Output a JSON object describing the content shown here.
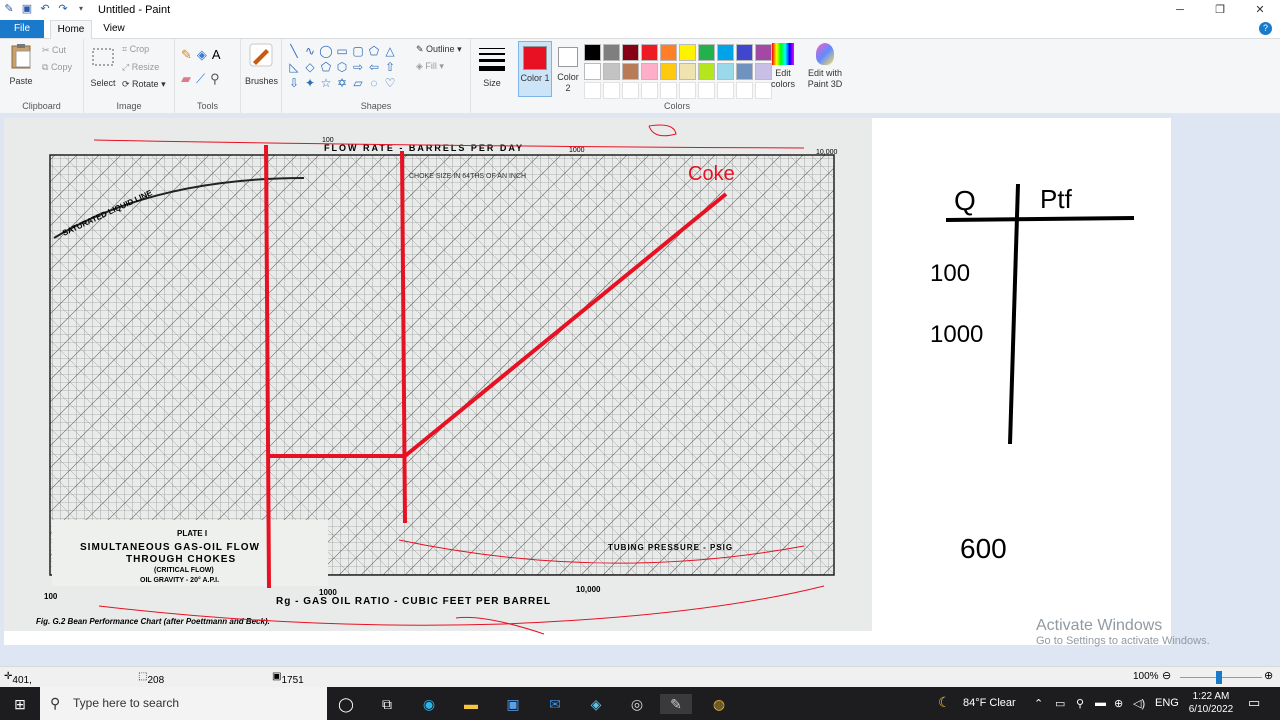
{
  "window": {
    "title": "Untitled - Paint",
    "controls": [
      "minimize-icon",
      "maximize-icon",
      "close-icon"
    ]
  },
  "tabs": {
    "file": "File",
    "home": "Home",
    "view": "View"
  },
  "ribbon": {
    "clipboard": {
      "paste": "Paste",
      "cut": "Cut",
      "copy": "Copy",
      "label": "Clipboard"
    },
    "image": {
      "select": "Select",
      "crop": "Crop",
      "resize": "Resize",
      "rotate": "Rotate",
      "label": "Image"
    },
    "tools": {
      "label": "Tools"
    },
    "brushes": {
      "label": "Brushes"
    },
    "shapes": {
      "outline": "Outline",
      "fill": "Fill",
      "label": "Shapes"
    },
    "size": {
      "label": "Size"
    },
    "colors": {
      "color1": "Color 1",
      "color2": "Color 2",
      "edit_colors": "Edit colors",
      "edit_paint3d": "Edit with Paint 3D",
      "label": "Colors",
      "color1_value": "#e81123",
      "color2_value": "#ffffff",
      "palette": [
        "#000000",
        "#7f7f7f",
        "#880015",
        "#ed1c24",
        "#ff7f27",
        "#fff200",
        "#22b14c",
        "#00a2e8",
        "#3f48cc",
        "#a349a4",
        "#ffffff",
        "#c3c3c3",
        "#b97a57",
        "#ffaec9",
        "#ffc90e",
        "#efe4b0",
        "#b5e61d",
        "#99d9ea",
        "#7092be",
        "#c8bfe7"
      ]
    }
  },
  "chart_image": {
    "top_label": "FLOW RATE - BARRELS PER DAY",
    "top_ticks": [
      "100",
      "1000",
      "10,000"
    ],
    "choke_label": "CHOKE SIZE IN 64THS OF AN INCH",
    "liquid_line": "SATURATED LIQUID LINE",
    "plate_title": "PLATE I",
    "plate_line1": "SIMULTANEOUS GAS-OIL FLOW",
    "plate_line2": "THROUGH CHOKES",
    "plate_line3": "(CRITICAL FLOW)",
    "plate_line4": "OIL GRAVITY - 20° A.P.I.",
    "tubing_pressure": "TUBING PRESSURE - PSIG",
    "bottom_label": "Rg - GAS OIL RATIO - CUBIC FEET PER BARREL",
    "bottom_ticks": [
      "100",
      "1000",
      "10,000"
    ],
    "caption": "Fig. G.2  Bean Performance Chart (after Poettmann and Beck).",
    "annotation": "Coke"
  },
  "whiteboard": {
    "col1": "Q",
    "col2": "Ptf",
    "v1": "100",
    "v2": "1000",
    "v3": "600"
  },
  "watermark": {
    "line1": "Activate Windows",
    "line2": "Go to Settings to activate Windows."
  },
  "status": {
    "cursor": "401, 490px",
    "selection": "208 × 5px",
    "canvas_size": "1751 × 793px",
    "zoom": "100%"
  },
  "taskbar": {
    "search_placeholder": "Type here to search",
    "weather": "84°F Clear",
    "lang": "ENG",
    "time": "1:22 AM",
    "date": "6/10/2022"
  }
}
